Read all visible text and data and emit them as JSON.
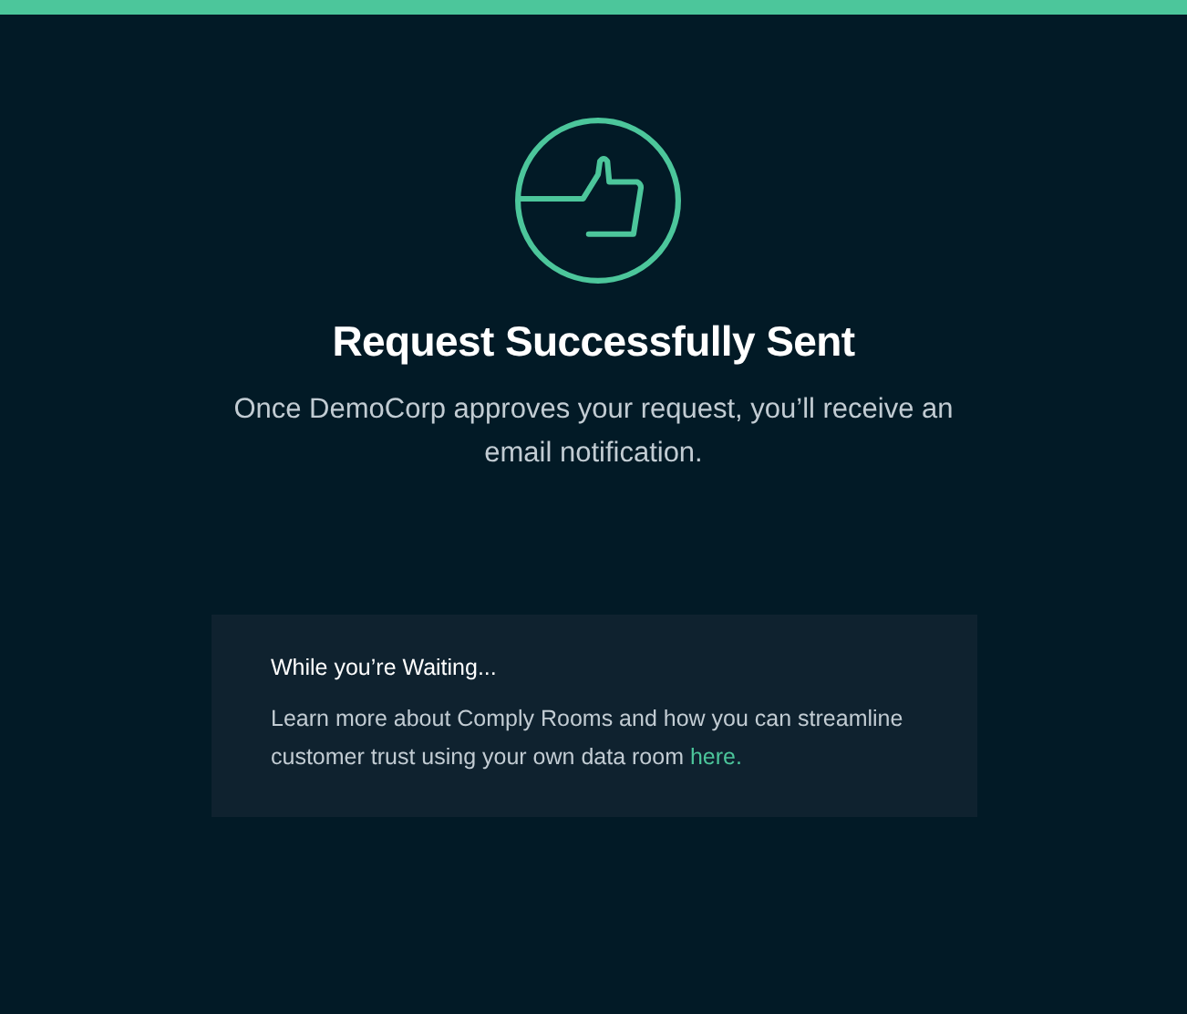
{
  "title": "Request Successfully Sent",
  "message": "Once DemoCorp approves your request, you’ll receive an email notification.",
  "card": {
    "title": "While you’re Waiting...",
    "text": "Learn more about Comply Rooms and how you can streamline customer trust using your own data room ",
    "link": "here."
  }
}
